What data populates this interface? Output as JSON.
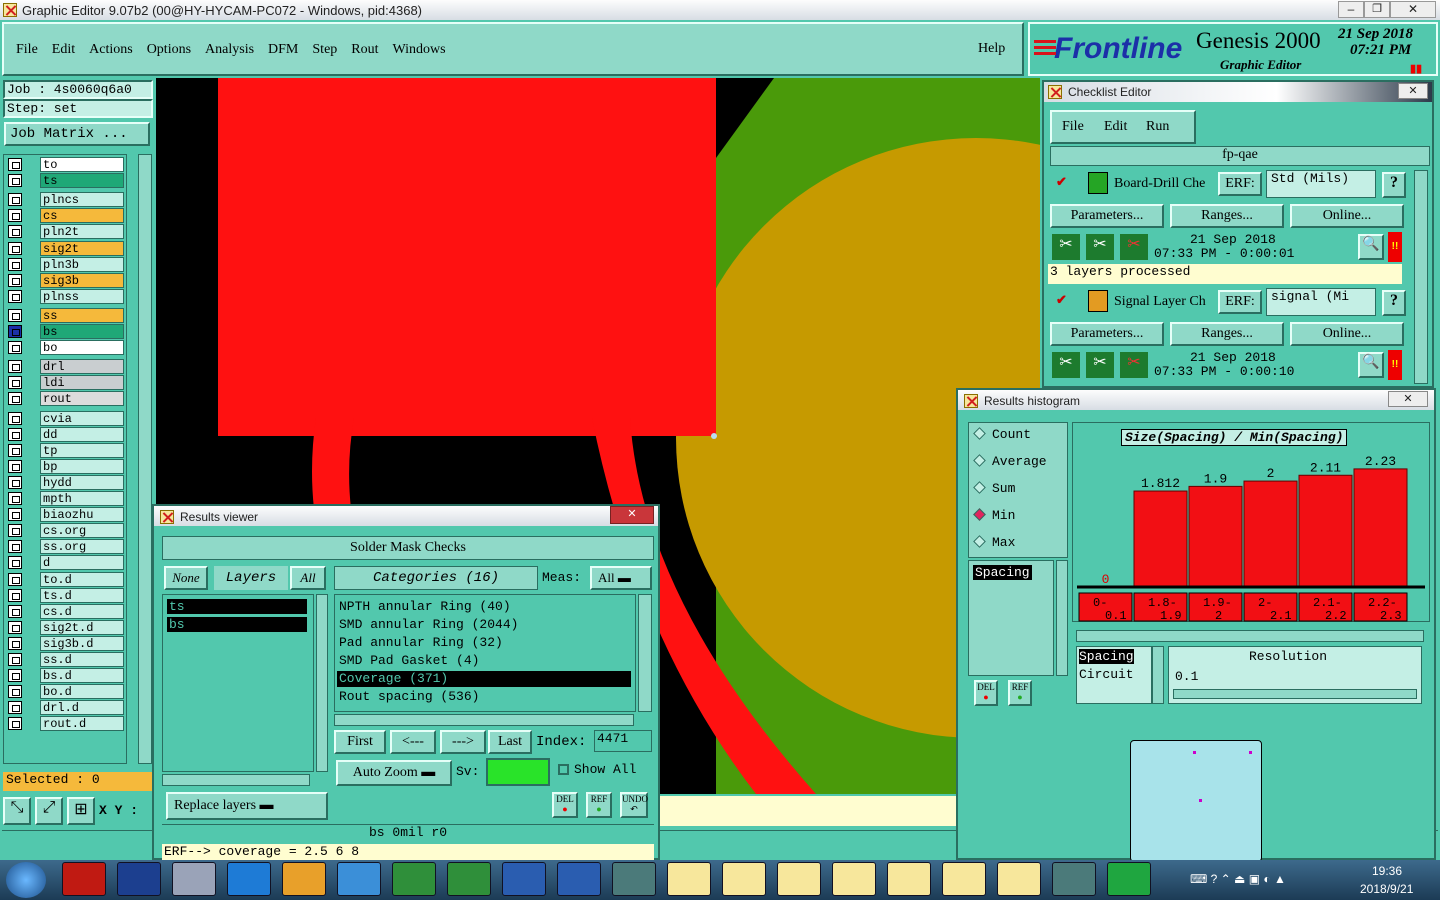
{
  "window_title": "Graphic Editor 9.07b2 (00@HY-HYCAM-PC072 - Windows, pid:4368)",
  "menu": [
    "File",
    "Edit",
    "Actions",
    "Options",
    "Analysis",
    "DFM",
    "Step",
    "Rout",
    "Windows"
  ],
  "help_label": "Help",
  "brand": {
    "logo": "Frontline",
    "product": "Genesis 2000",
    "subtitle": "Graphic Editor",
    "date": "21 Sep 2018",
    "time": "07:21 PM"
  },
  "job": {
    "job_label": "Job : 4s0060q6a0",
    "step_label": "Step: set",
    "matrix_button": "Job Matrix ..."
  },
  "layers": [
    {
      "name": "to",
      "color": "#ffffff"
    },
    {
      "name": "ts",
      "color": "#1fa877"
    },
    {
      "name": "plncs",
      "color": "#c4efe5"
    },
    {
      "name": "cs",
      "color": "#f5b93b"
    },
    {
      "name": "pln2t",
      "color": "#c4efe5"
    },
    {
      "name": "sig2t",
      "color": "#f5b93b"
    },
    {
      "name": "pln3b",
      "color": "#c4efe5"
    },
    {
      "name": "sig3b",
      "color": "#f5b93b"
    },
    {
      "name": "plnss",
      "color": "#c4efe5"
    },
    {
      "name": "ss",
      "color": "#f5b93b"
    },
    {
      "name": "bs",
      "color": "#1fa877"
    },
    {
      "name": "bo",
      "color": "#ffffff"
    },
    {
      "name": "drl",
      "color": "#c9ced0"
    },
    {
      "name": "ldi",
      "color": "#c9ced0"
    },
    {
      "name": "rout",
      "color": "#dcdcdc"
    },
    {
      "name": "cvia",
      "color": "#c4efe5"
    },
    {
      "name": "dd",
      "color": "#c4efe5"
    },
    {
      "name": "tp",
      "color": "#c4efe5"
    },
    {
      "name": "bp",
      "color": "#c4efe5"
    },
    {
      "name": "hydd",
      "color": "#c4efe5"
    },
    {
      "name": "mpth",
      "color": "#c4efe5"
    },
    {
      "name": "biaozhu",
      "color": "#c4efe5"
    },
    {
      "name": "cs.org",
      "color": "#c4efe5"
    },
    {
      "name": "ss.org",
      "color": "#c4efe5"
    },
    {
      "name": "d",
      "color": "#c4efe5"
    },
    {
      "name": "to.d",
      "color": "#c4efe5"
    },
    {
      "name": "ts.d",
      "color": "#c4efe5"
    },
    {
      "name": "cs.d",
      "color": "#c4efe5"
    },
    {
      "name": "sig2t.d",
      "color": "#c4efe5"
    },
    {
      "name": "sig3b.d",
      "color": "#c4efe5"
    },
    {
      "name": "ss.d",
      "color": "#c4efe5"
    },
    {
      "name": "bs.d",
      "color": "#c4efe5"
    },
    {
      "name": "bo.d",
      "color": "#c4efe5"
    },
    {
      "name": "drl.d",
      "color": "#c4efe5"
    },
    {
      "name": "rout.d",
      "color": "#c4efe5"
    }
  ],
  "selected_label": "Selected : 0",
  "xy_label": "X Y :",
  "checklist": {
    "title": "Checklist Editor",
    "menu": [
      "File",
      "Edit",
      "Run"
    ],
    "name": "fp-qae",
    "actions": [
      {
        "name": "Board-Drill Che",
        "erf_label": "ERF:",
        "erf_value": "Std (Mils)",
        "buttons": [
          "Parameters...",
          "Ranges...",
          "Online..."
        ],
        "date": "21 Sep 2018",
        "time": "07:33 PM - 0:00:01",
        "status": "3 layers processed"
      },
      {
        "name": "Signal Layer Ch",
        "erf_label": "ERF:",
        "erf_value": "signal (Mi",
        "buttons": [
          "Parameters...",
          "Ranges...",
          "Online..."
        ],
        "date": "21 Sep 2018",
        "time": "07:33 PM - 0:00:10"
      }
    ]
  },
  "histogram": {
    "title": "Results histogram",
    "modes": [
      "Count",
      "Average",
      "Sum",
      "Min",
      "Max"
    ],
    "selected_mode": "Min",
    "chart_title": "Size(Spacing) / Min(Spacing)",
    "list_selected": "Spacing",
    "categories": [
      "0-\n0.1",
      "1.8-\n1.9",
      "1.9-\n2",
      "2-\n2.1",
      "2.1-\n2.2",
      "2.2-\n2.3"
    ],
    "values": [
      0,
      1.812,
      1.9,
      2,
      2.11,
      2.23
    ],
    "value_labels": [
      "0",
      "1.812",
      "1.9",
      "2",
      "2.11",
      "2.23"
    ],
    "lower_list": [
      "Spacing",
      "Circuit"
    ],
    "resolution_label": "Resolution",
    "resolution_value": "0.1",
    "del_label": "DEL",
    "ref_label": "REF"
  },
  "results_viewer": {
    "title": "Results viewer",
    "header": "Solder Mask Checks",
    "none_label": "None",
    "layers_label": "Layers",
    "all_label": "All",
    "categories_label": "Categories (16)",
    "meas_label": "Meas:",
    "meas_value": "All",
    "layers": [
      "ts",
      "bs"
    ],
    "categories": [
      "NPTH annular Ring (40)",
      "SMD annular Ring (2044)",
      "Pad annular Ring (32)",
      "SMD Pad Gasket (4)",
      "Coverage (371)",
      "Rout spacing (536)"
    ],
    "selected_category": "Coverage (371)",
    "nav": [
      "First",
      "<---",
      "--->",
      "Last"
    ],
    "index_label": "Index:",
    "index_value": "4471",
    "auto_zoom": "Auto Zoom",
    "sv_label": "Sv:",
    "show_all": "Show All",
    "replace_layers": "Replace layers",
    "del": "DEL",
    "ref": "REF",
    "undo": "UNDO",
    "status": "bs 0mil r0",
    "erf_line": "ERF--> coverage = 2.5 6 8"
  },
  "taskbar": {
    "time": "19:36",
    "date": "2018/9/21"
  },
  "colors": {
    "panel": "#52c8ad",
    "canvas": "#000000",
    "pad_red": "#ff1111",
    "green": "#4a9a0a",
    "gold": "#c69a00"
  }
}
